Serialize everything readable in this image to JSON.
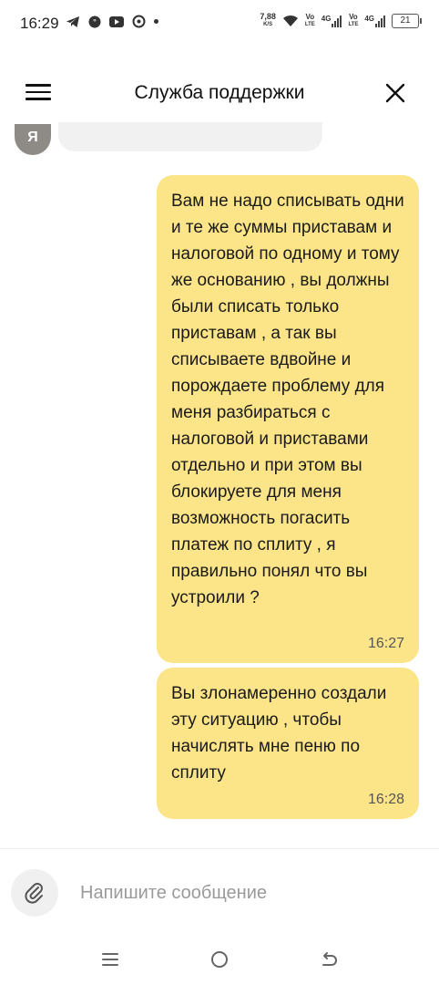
{
  "status_bar": {
    "time": "16:29",
    "speed_value": "7,88",
    "speed_unit": "K/S",
    "net1": "Vo",
    "net1_sub": "LTE",
    "gen1": "4G",
    "net2": "Vo",
    "net2_sub": "LTE",
    "gen2": "4G",
    "battery": "21"
  },
  "header": {
    "title": "Служба поддержки"
  },
  "chat": {
    "avatar_letter": "Я",
    "messages": [
      {
        "text": "Вам не надо списывать одни и те же суммы приставам и налоговой по одному и тому же основанию , вы должны были списать только приставам , а так вы списываете вдвойне и порождаете проблему для меня разбираться с налоговой и приставами отдельно и при этом вы блокируете для меня возможность погасить платеж по сплиту , я правильно понял что вы устроили ?",
        "time": "16:27"
      },
      {
        "text": "Вы злонамеренно создали эту ситуацию , чтобы начислять мне пеню по сплиту",
        "time": "16:28"
      }
    ]
  },
  "composer": {
    "placeholder": "Напишите сообщение"
  },
  "colors": {
    "bubble": "#fce588",
    "background": "#ffffff"
  }
}
